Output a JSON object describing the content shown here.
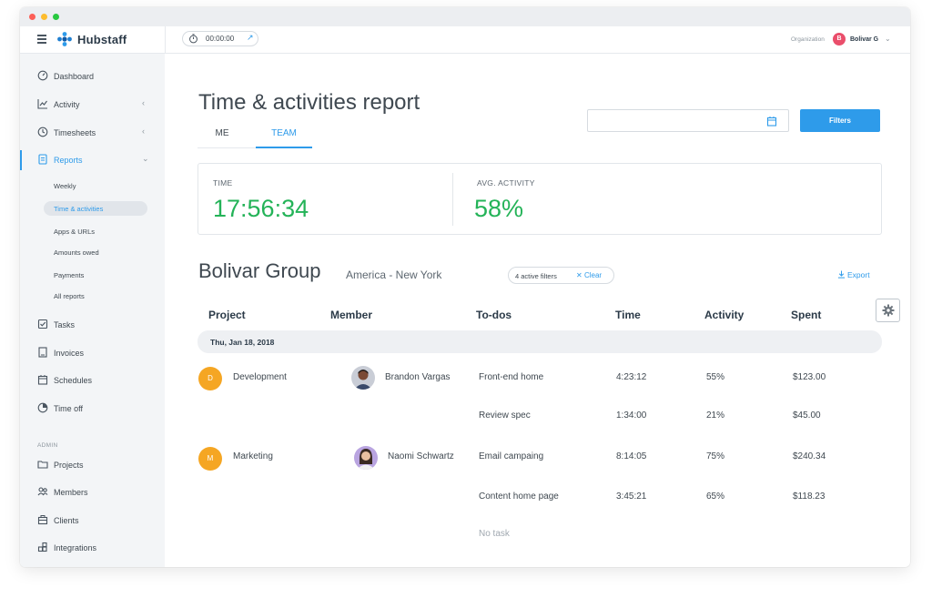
{
  "app": {
    "brand": "Hubstaff",
    "timer": "00:00:00",
    "organization_label": "Organization",
    "user_initial": "B",
    "user_name": "Bolivar G"
  },
  "colors": {
    "accent": "#2e9bea",
    "success": "#24b358",
    "project_badge": "#f5a623",
    "avatar_badge": "#ea4e6b"
  },
  "sidebar": {
    "items": [
      {
        "label": "Dashboard",
        "icon": "dashboard-icon"
      },
      {
        "label": "Activity",
        "icon": "activity-chart-icon"
      },
      {
        "label": "Timesheets",
        "icon": "clock-icon"
      },
      {
        "label": "Reports",
        "icon": "report-document-icon"
      },
      {
        "label": "Tasks",
        "icon": "checkbox-icon"
      },
      {
        "label": "Invoices",
        "icon": "invoice-icon"
      },
      {
        "label": "Schedules",
        "icon": "calendar-icon"
      },
      {
        "label": "Time off",
        "icon": "pie-clock-icon"
      },
      {
        "label": "Projects",
        "icon": "folder-icon"
      },
      {
        "label": "Members",
        "icon": "members-icon"
      },
      {
        "label": "Clients",
        "icon": "briefcase-icon"
      },
      {
        "label": "Integrations",
        "icon": "integrations-icon"
      }
    ],
    "report_subitems": [
      {
        "label": "Weekly"
      },
      {
        "label": "Time & activities"
      },
      {
        "label": "Apps & URLs"
      },
      {
        "label": "Amounts owed"
      },
      {
        "label": "Payments"
      },
      {
        "label": "All reports"
      }
    ],
    "admin_label": "ADMIN"
  },
  "page": {
    "title": "Time & activities report",
    "tabs": [
      {
        "label": "ME"
      },
      {
        "label": "TEAM"
      }
    ],
    "date_value": "",
    "filters_label": "Filters"
  },
  "stats": {
    "time_label": "TIME",
    "time_value": "17:56:34",
    "activity_label": "AVG. ACTIVITY",
    "activity_value": "58%"
  },
  "group": {
    "name": "Bolivar Group",
    "timezone": "America - New York",
    "filters_text": "4 active filters",
    "clear_label": "Clear",
    "export_label": "Export"
  },
  "table": {
    "columns": [
      "Project",
      "Member",
      "To-dos",
      "Time",
      "Activity",
      "Spent"
    ],
    "date": "Thu, Jan 18, 2018",
    "rows": [
      {
        "project_initial": "D",
        "project": "Development",
        "member": "Brandon Vargas",
        "todo": "Front-end home",
        "time": "4:23:12",
        "activity": "55%",
        "spent": "$123.00"
      },
      {
        "project_initial": "",
        "project": "",
        "member": "",
        "todo": "Review spec",
        "time": "1:34:00",
        "activity": "21%",
        "spent": "$45.00"
      },
      {
        "project_initial": "M",
        "project": "Marketing",
        "member": "Naomi Schwartz",
        "todo": "Email campaing",
        "time": "8:14:05",
        "activity": "75%",
        "spent": "$240.34"
      },
      {
        "project_initial": "",
        "project": "",
        "member": "",
        "todo": "Content home page",
        "time": "3:45:21",
        "activity": "65%",
        "spent": "$118.23"
      },
      {
        "project_initial": "",
        "project": "",
        "member": "",
        "todo": "No task",
        "time": "",
        "activity": "",
        "spent": ""
      }
    ]
  }
}
